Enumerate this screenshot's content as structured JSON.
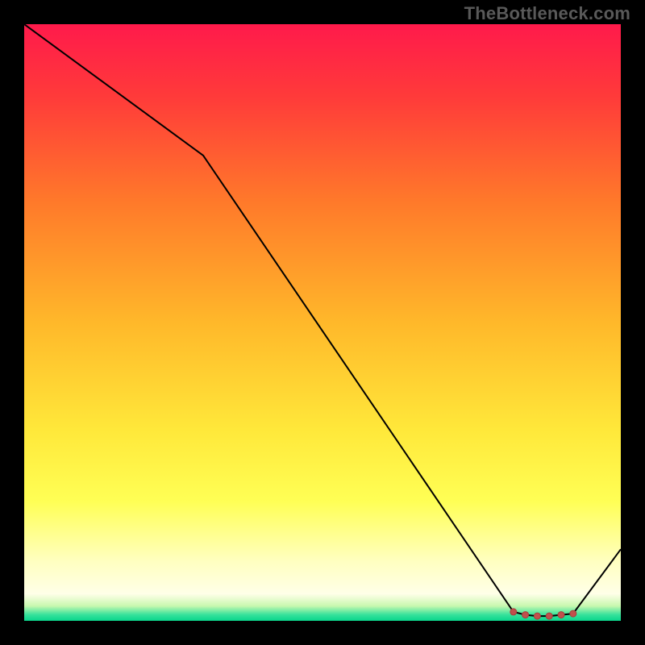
{
  "watermark": "TheBottleneck.com",
  "gradient_stops": [
    {
      "offset": 0.0,
      "color": "#ff1a4b"
    },
    {
      "offset": 0.12,
      "color": "#ff3a3a"
    },
    {
      "offset": 0.3,
      "color": "#ff7a2a"
    },
    {
      "offset": 0.5,
      "color": "#ffb82a"
    },
    {
      "offset": 0.68,
      "color": "#ffe83a"
    },
    {
      "offset": 0.8,
      "color": "#ffff55"
    },
    {
      "offset": 0.9,
      "color": "#ffffc0"
    },
    {
      "offset": 0.955,
      "color": "#ffffe8"
    },
    {
      "offset": 0.975,
      "color": "#c8f8af"
    },
    {
      "offset": 0.99,
      "color": "#35e19b"
    },
    {
      "offset": 1.0,
      "color": "#0ad68c"
    }
  ],
  "chart_data": {
    "type": "line",
    "title": "",
    "xlabel": "",
    "ylabel": "",
    "xlim": [
      0,
      100
    ],
    "ylim": [
      0,
      100
    ],
    "x": [
      0,
      30,
      82,
      84,
      86,
      88,
      90,
      92,
      100
    ],
    "values": [
      100,
      78,
      1.5,
      1.0,
      0.8,
      0.8,
      1.0,
      1.2,
      12
    ],
    "markers_x": [
      82,
      84,
      86,
      88,
      90,
      92
    ],
    "markers_y": [
      1.5,
      1.0,
      0.8,
      0.8,
      1.0,
      1.2
    ]
  }
}
